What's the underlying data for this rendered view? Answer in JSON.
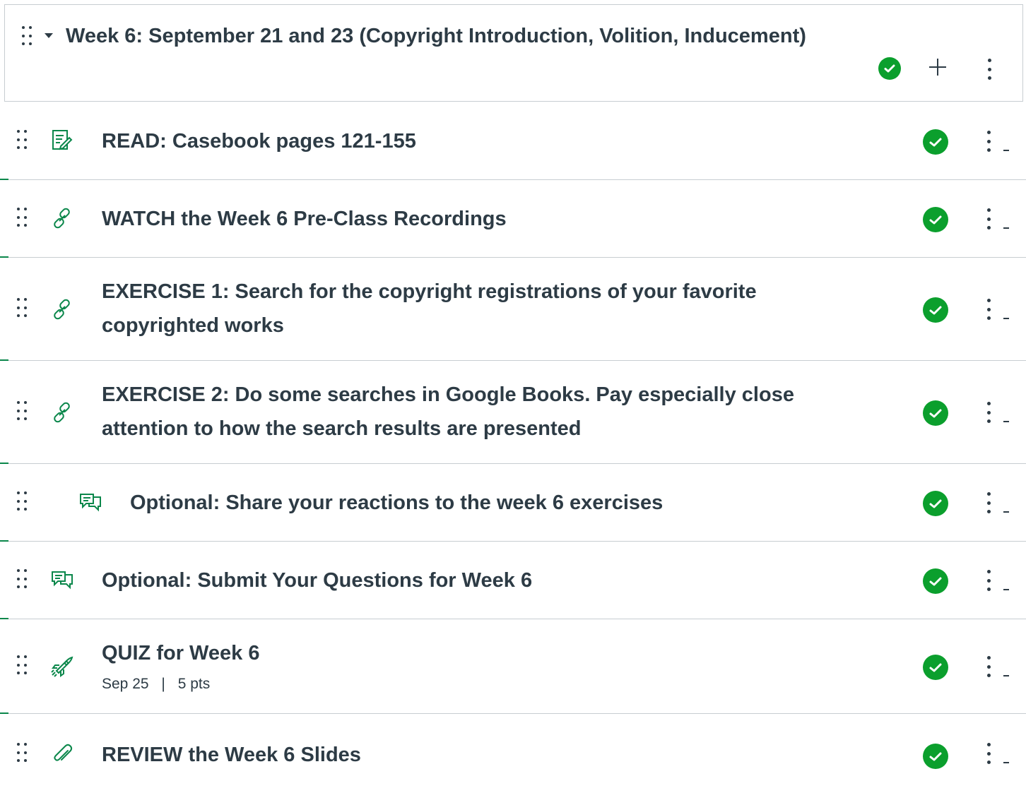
{
  "module": {
    "title": "Week 6: September 21 and 23 (Copyright Introduction, Volition, Inducement)",
    "colors": {
      "accent": "#0b874b",
      "published": "#0b9f2d",
      "text": "#2d3b45",
      "border": "#c7cdd1"
    }
  },
  "items": [
    {
      "icon": "assignment-icon",
      "title": "READ: Casebook pages 121-155"
    },
    {
      "icon": "link-icon",
      "title": "WATCH the Week 6 Pre-Class Recordings"
    },
    {
      "icon": "link-icon",
      "title": "EXERCISE 1: Search for the copyright registrations of your favorite copyrighted works"
    },
    {
      "icon": "link-icon",
      "title": "EXERCISE 2: Do some searches in Google Books. Pay especially close attention to how the search results are presented"
    },
    {
      "icon": "discussion-icon",
      "title": "Optional: Share your reactions to the week 6 exercises"
    },
    {
      "icon": "discussion-icon",
      "title": "Optional: Submit Your Questions for Week 6"
    },
    {
      "icon": "quiz-icon",
      "title": "QUIZ for Week 6",
      "due": "Sep 25",
      "separator": "|",
      "points": "5 pts"
    },
    {
      "icon": "attachment-icon",
      "title": "REVIEW the Week 6 Slides"
    }
  ]
}
